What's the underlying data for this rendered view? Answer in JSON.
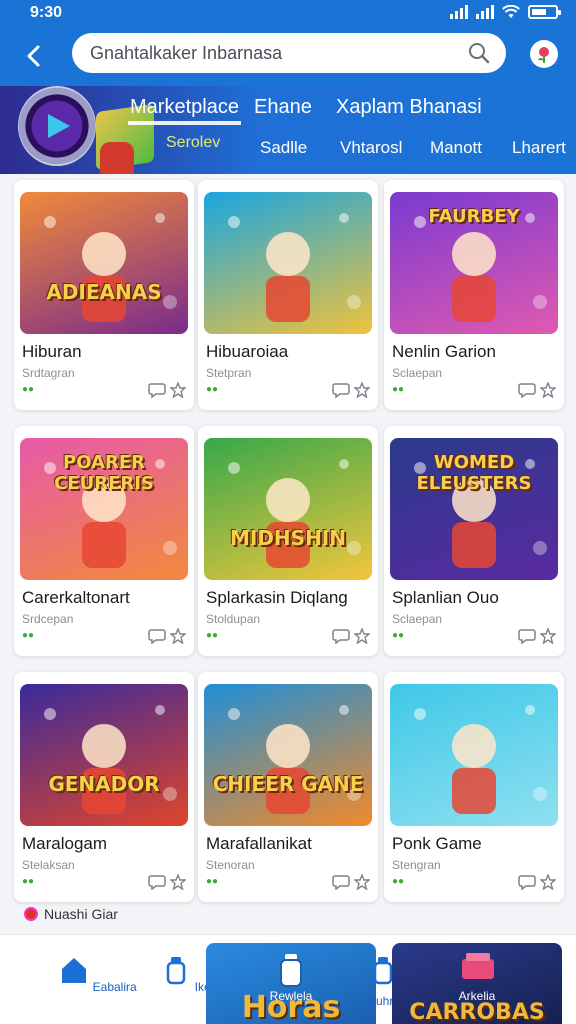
{
  "status_bar": {
    "time": "9:30"
  },
  "header": {
    "search_value": "Gnahtalkaker Inbarnasa"
  },
  "tabs_primary": [
    {
      "label": "Marketplace"
    },
    {
      "label": "Ehane"
    },
    {
      "label": "Xaplam Bhanasi"
    }
  ],
  "tabs_secondary": [
    {
      "label": "Sadlle"
    },
    {
      "label": "Vhtarosl"
    },
    {
      "label": "Manott"
    },
    {
      "label": "Lharert"
    }
  ],
  "banner_accent": "Serolev",
  "cards": [
    {
      "name": "Hiburan",
      "sub": "Srdtagran",
      "art": "ADIEANAS",
      "art_pos": "bottom",
      "colors": [
        "#f08a3a",
        "#7a2b8c"
      ]
    },
    {
      "name": "Hibuaroiaa",
      "sub": "Stetpran",
      "art": "",
      "art_pos": "bottom",
      "colors": [
        "#1aa6e0",
        "#f0c23c"
      ]
    },
    {
      "name": "Nenlin Garion",
      "sub": "Sclaepan",
      "art": "FAURBEY",
      "art_pos": "top",
      "colors": [
        "#7a3ad0",
        "#e05ab0"
      ]
    },
    {
      "name": "Carerkaltonart",
      "sub": "Srdcepan",
      "art": "POARER CEURERIS",
      "art_pos": "top",
      "colors": [
        "#e65aa8",
        "#f28a3c"
      ]
    },
    {
      "name": "Splarkasin Diqlang",
      "sub": "Stoldupan",
      "art": "MIDHSHIN",
      "art_pos": "bottom",
      "colors": [
        "#36a84a",
        "#f2c63c"
      ]
    },
    {
      "name": "Splanlian Ouo",
      "sub": "Sclaepan",
      "art": "WOMED ELEUSTERS",
      "art_pos": "top",
      "colors": [
        "#2a3a8c",
        "#5a2aa0"
      ]
    },
    {
      "name": "Maralogam",
      "sub": "Stelaksan",
      "art": "GENADOR",
      "art_pos": "bottom",
      "colors": [
        "#3a2a9c",
        "#e0452a"
      ]
    },
    {
      "name": "Marafallanikat",
      "sub": "Stenoran",
      "art": "CHIEER GANE",
      "art_pos": "bottom",
      "colors": [
        "#1f8fd8",
        "#f28a2a"
      ]
    },
    {
      "name": "Ponk Game",
      "sub": "Stengran",
      "art": "",
      "art_pos": "bottom",
      "colors": [
        "#3fc8e8",
        "#8fe0f0"
      ]
    }
  ],
  "hint": "Nuashi Giar",
  "bottom_nav": [
    {
      "label": "Eabalira"
    },
    {
      "label": "Ikes"
    },
    {
      "label": "Auhrua"
    }
  ],
  "promo": [
    {
      "title": "Horas",
      "label": "Rewlela"
    },
    {
      "title": "CARROBAS",
      "label": "Arkelia"
    }
  ]
}
